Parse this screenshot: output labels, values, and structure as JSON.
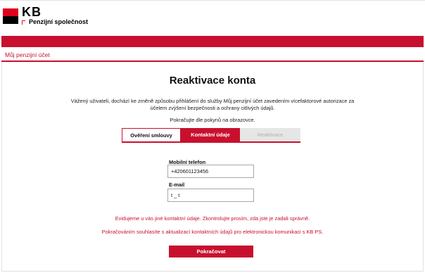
{
  "brand": {
    "name": "KB",
    "subtitle": "Penzijní společnost",
    "color_red": "#c8102e",
    "color_black": "#000000"
  },
  "nav": {
    "link_label": "Můj penzijní účet"
  },
  "page": {
    "title": "Reaktivace konta",
    "intro": "Vážený uživateli, dochází ke změně způsobu přihlášení do služby Můj penzijní účet zavedením vícefaktorové autorizace za účelem zvýšení bezpečnosti a ochrany citlivých údajů.",
    "instruction": "Pokračujte dle pokynů na obrazovce."
  },
  "steps": [
    {
      "label": "Ověření smlouvy",
      "state": "done"
    },
    {
      "label": "Kontaktní údaje",
      "state": "active"
    },
    {
      "label": "Reaktivace",
      "state": "disabled"
    }
  ],
  "form": {
    "phone_label": "Mobilní telefon",
    "phone_value": "+420601123456",
    "email_label": "E-mail",
    "email_value": "t _ t"
  },
  "messages": {
    "mismatch": "Evidujeme u vás jiné kontaktní údaje. Zkontrolujte prosím, zda jste je zadali správně.",
    "consent": "Pokračováním souhlasíte s aktualizací kontaktních údajů pro elektronickou komunikaci s KB PS."
  },
  "actions": {
    "continue_label": "Pokračovat"
  }
}
